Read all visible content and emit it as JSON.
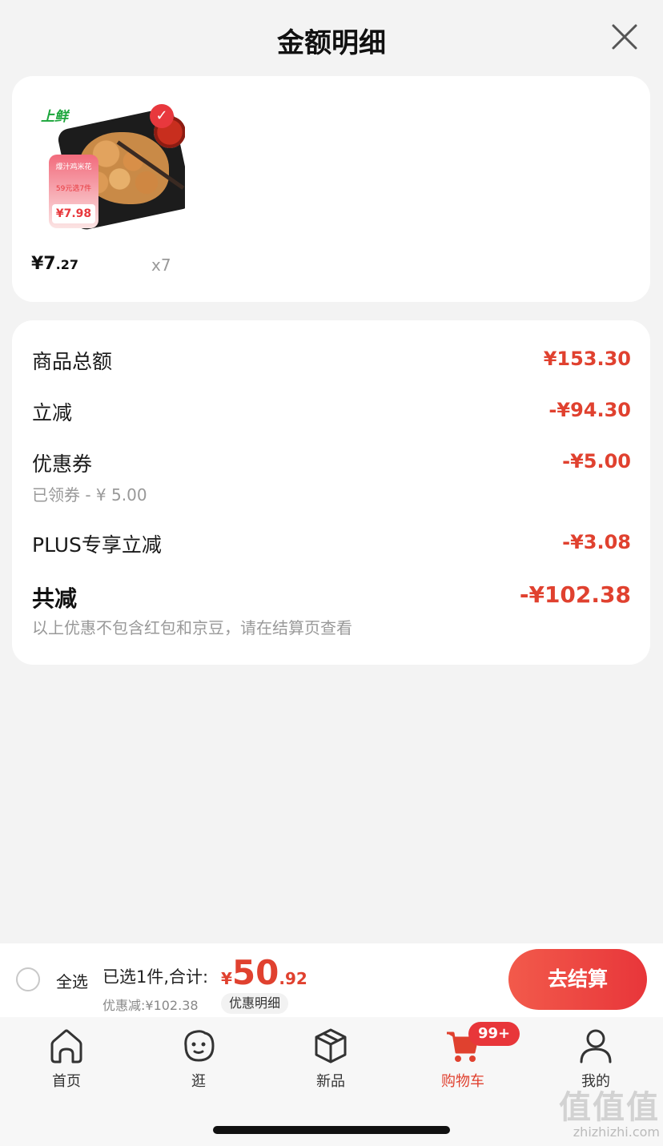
{
  "header": {
    "title": "金额明细"
  },
  "product": {
    "brand_logo": "上鲜",
    "promo_line1": "爆汁鸡米花",
    "promo_line2": "59元选7件",
    "promo_price": "¥7.98",
    "price_int": "¥7",
    "price_dec": ".27",
    "quantity": "x7"
  },
  "details": {
    "rows": [
      {
        "label": "商品总额",
        "amount": "¥153.30"
      },
      {
        "label": "立减",
        "amount": "-¥94.30"
      },
      {
        "label": "优惠券",
        "amount": "-¥5.00",
        "sub": "已领券 - ¥ 5.00"
      },
      {
        "label": "PLUS专享立减",
        "amount": "-¥3.08"
      }
    ],
    "total": {
      "label": "共减",
      "amount": "-¥102.38",
      "note": "以上优惠不包含红包和京豆，请在结算页查看"
    }
  },
  "bottom_bar": {
    "select_all": "全选",
    "selected_info": "已选1件,合计:",
    "total_yen": "¥",
    "total_int": "50",
    "total_dec": ".92",
    "discount_info": "优惠减:¥102.38",
    "detail_chip": "优惠明细",
    "checkout": "去结算"
  },
  "tabbar": {
    "items": [
      {
        "label": "首页",
        "icon": "home-icon"
      },
      {
        "label": "逛",
        "icon": "face-icon"
      },
      {
        "label": "新品",
        "icon": "box-icon"
      },
      {
        "label": "购物车",
        "icon": "cart-icon"
      },
      {
        "label": "我的",
        "icon": "user-icon"
      }
    ],
    "cart_badge": "99+",
    "active_color": "#e0412f"
  },
  "watermark": {
    "line1": "值值值",
    "line2": "zhizhizhi.com"
  },
  "colors": {
    "accent": "#e0412f",
    "checkout_gradient_start": "#f25a4b",
    "checkout_gradient_end": "#e8363a"
  }
}
